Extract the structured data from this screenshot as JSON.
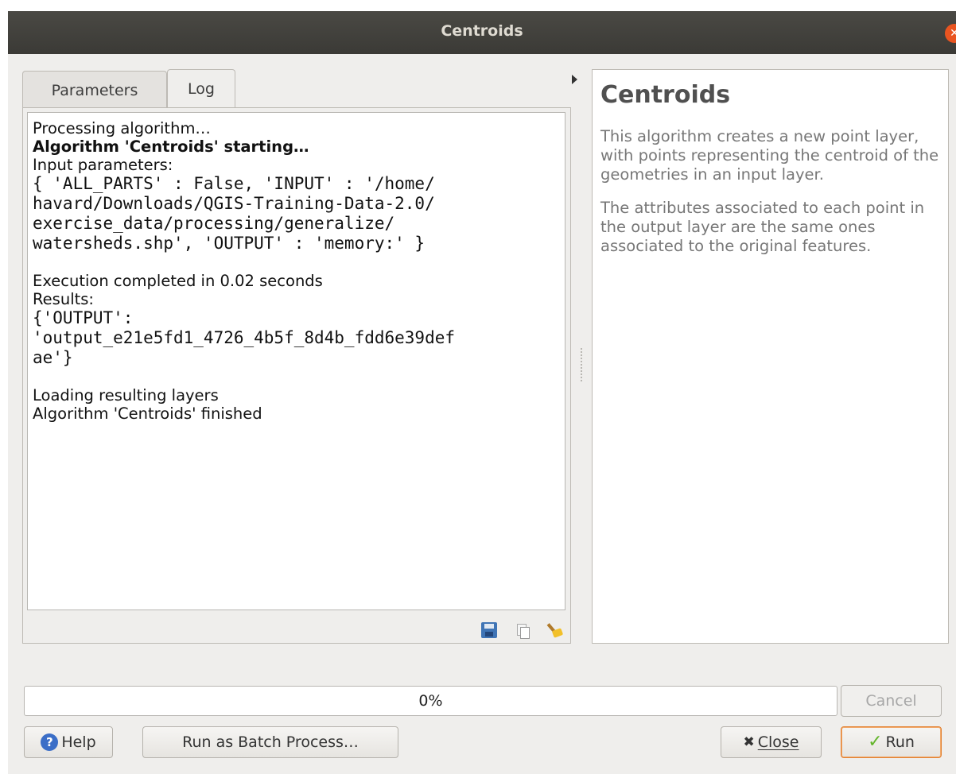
{
  "window": {
    "title": "Centroids",
    "close_icon": "close-icon"
  },
  "tabs": [
    {
      "label": "Parameters",
      "active": false
    },
    {
      "label": "Log",
      "active": true
    }
  ],
  "log": {
    "lines": [
      "Processing algorithm…",
      "Algorithm 'Centroids' starting…",
      "Input parameters:",
      "{ 'ALL_PARTS' : False, 'INPUT' : '/home/",
      "havard/Downloads/QGIS-Training-Data-2.0/",
      "exercise_data/processing/generalize/",
      "watersheds.shp', 'OUTPUT' : 'memory:' }",
      "Execution completed in 0.02 seconds",
      "Results:",
      "{'OUTPUT':",
      "'output_e21e5fd1_4726_4b5f_8d4b_fdd6e39def",
      "ae'}",
      "Loading resulting layers",
      "Algorithm 'Centroids' finished"
    ],
    "tools": [
      "save-icon",
      "copy-icon",
      "clear-icon"
    ]
  },
  "help": {
    "title": "Centroids",
    "paragraphs": [
      "This algorithm creates a new point layer, with points representing the centroid of the geometries in an input layer.",
      "The attributes associated to each point in the output layer are the same ones associated to the original features."
    ]
  },
  "progress": {
    "text": "0%",
    "value": 0
  },
  "buttons": {
    "cancel": "Cancel",
    "help": "Help",
    "batch": "Run as Batch Process…",
    "close": "Close",
    "run": "Run"
  }
}
